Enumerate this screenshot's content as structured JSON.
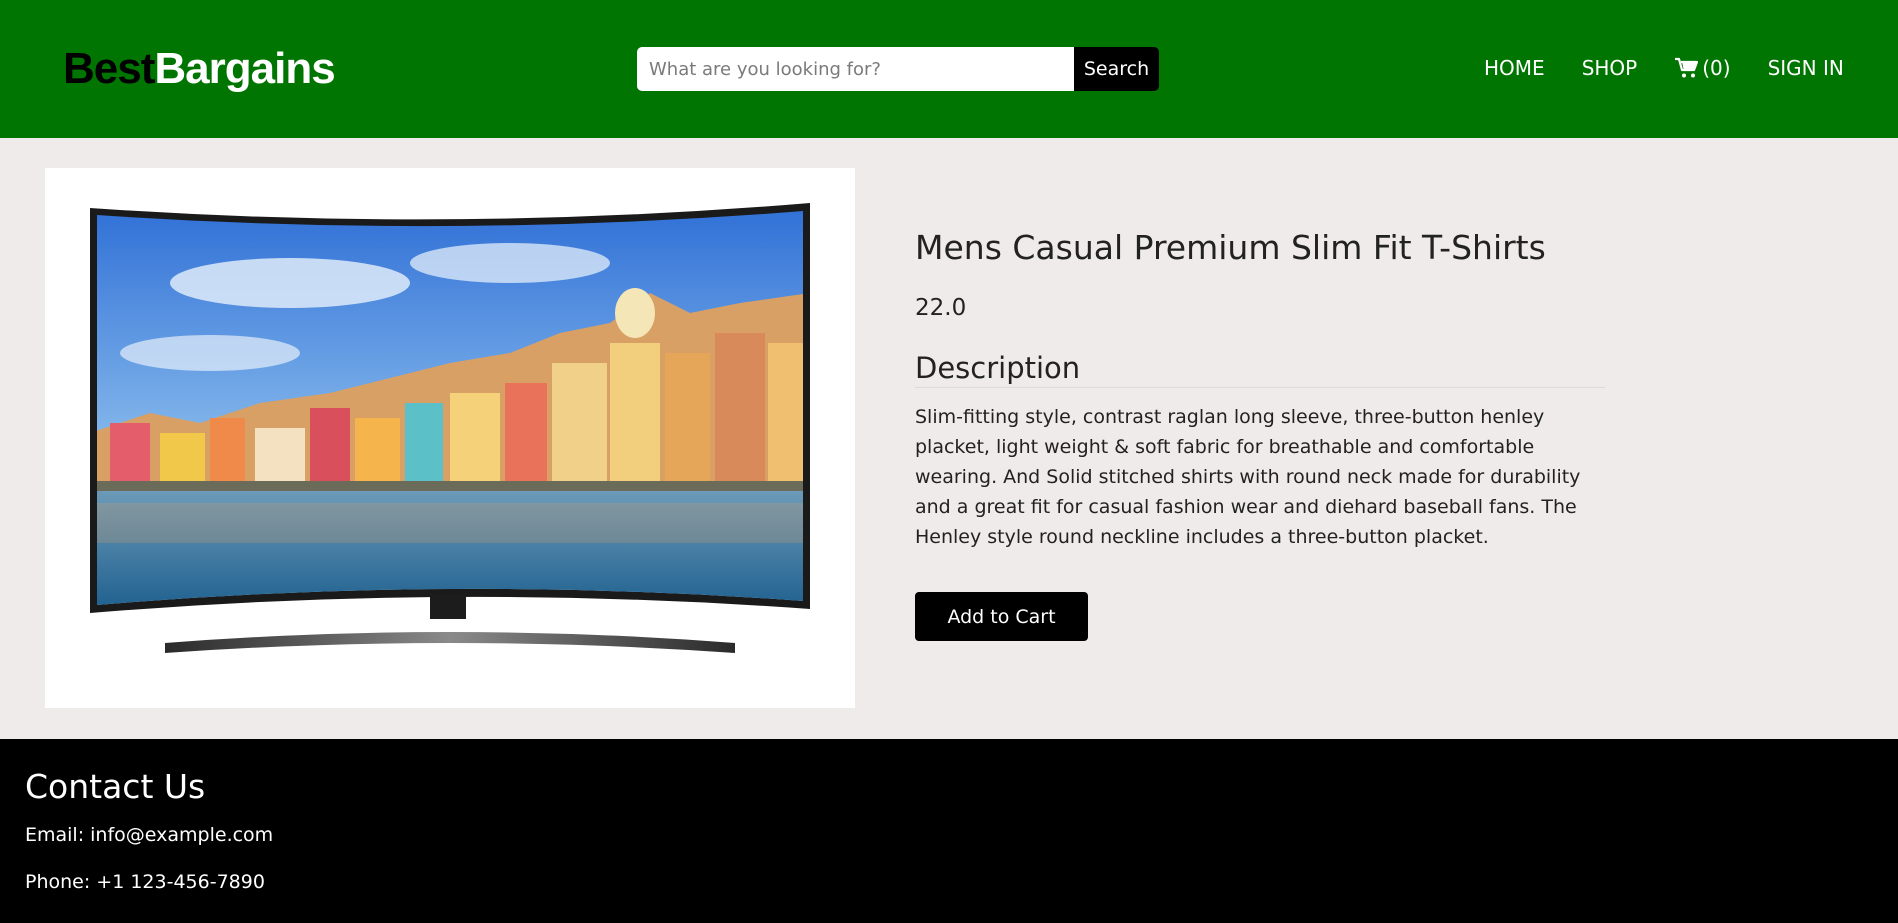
{
  "header": {
    "logo_part1": "Best",
    "logo_part2": "Bargains",
    "search": {
      "placeholder": "What are you looking for?",
      "button_label": "Search"
    },
    "nav": {
      "home": "HOME",
      "shop": "SHOP",
      "cart_count": "(0)",
      "sign_in": "SIGN IN"
    },
    "colors": {
      "header_bg": "#017501",
      "footer_bg": "#000000"
    }
  },
  "product": {
    "image_icon": "curved-tv-image",
    "title": "Mens Casual Premium Slim Fit T-Shirts",
    "price": "22.0",
    "description_heading": "Description",
    "description": "Slim-fitting style, contrast raglan long sleeve, three-button henley placket, light weight & soft fabric for breathable and comfortable wearing. And Solid stitched shirts with round neck made for durability and a great fit for casual fashion wear and diehard baseball fans. The Henley style round neckline includes a three-button placket.",
    "add_to_cart_label": "Add to Cart"
  },
  "footer": {
    "heading": "Contact Us",
    "email": "Email: info@example.com",
    "phone": "Phone: +1 123-456-7890"
  }
}
